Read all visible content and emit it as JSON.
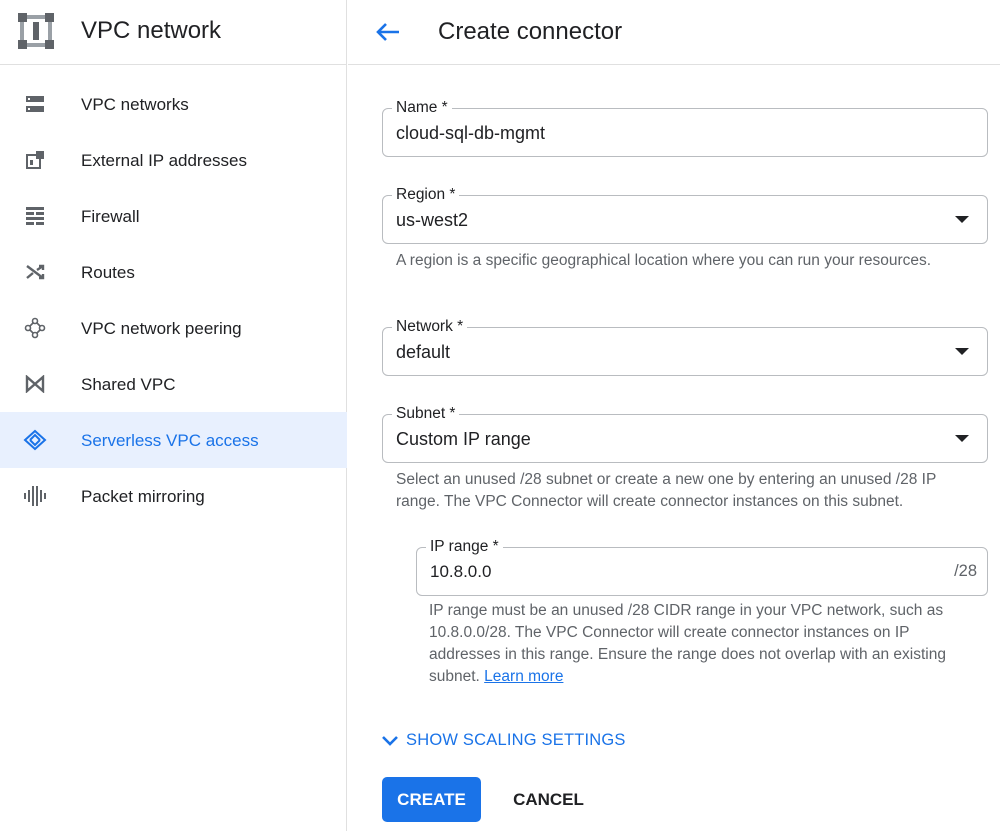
{
  "sidebar": {
    "product_title": "VPC network",
    "product_icon": "vpc-network-logo",
    "items": [
      {
        "label": "VPC networks",
        "icon": "vpc-networks-icon"
      },
      {
        "label": "External IP addresses",
        "icon": "external-ip-icon"
      },
      {
        "label": "Firewall",
        "icon": "firewall-icon"
      },
      {
        "label": "Routes",
        "icon": "routes-icon"
      },
      {
        "label": "VPC network peering",
        "icon": "peering-icon"
      },
      {
        "label": "Shared VPC",
        "icon": "shared-vpc-icon"
      },
      {
        "label": "Serverless VPC access",
        "icon": "serverless-vpc-icon",
        "active": true
      },
      {
        "label": "Packet mirroring",
        "icon": "packet-mirroring-icon"
      }
    ]
  },
  "header": {
    "title": "Create connector",
    "back_icon": "arrow-back-icon"
  },
  "form": {
    "name": {
      "label": "Name *",
      "value": "cloud-sql-db-mgmt"
    },
    "region": {
      "label": "Region *",
      "value": "us-west2",
      "hint": "A region is a specific geographical location where you can run your resources."
    },
    "network": {
      "label": "Network *",
      "value": "default"
    },
    "subnet": {
      "label": "Subnet *",
      "value": "Custom IP range",
      "hint": "Select an unused /28 subnet or create a new one by entering an unused /28 IP range. The VPC Connector will create connector instances on this subnet."
    },
    "ip_range": {
      "label": "IP range *",
      "value": "10.8.0.0",
      "suffix": "/28",
      "hint": "IP range must be an unused /28 CIDR range in your VPC network, such as 10.8.0.0/28. The VPC Connector will create connector instances on IP addresses in this range. Ensure the range does not overlap with an existing subnet.",
      "learn_more": "Learn more"
    }
  },
  "scaling": {
    "label": "SHOW SCALING SETTINGS",
    "icon": "chevron-down-icon"
  },
  "actions": {
    "create": "CREATE",
    "cancel": "CANCEL"
  },
  "colors": {
    "accent": "#1a73e8",
    "active_bg": "#e8f0fe",
    "border": "#b9bcc0",
    "hint_text": "#5f6368"
  }
}
